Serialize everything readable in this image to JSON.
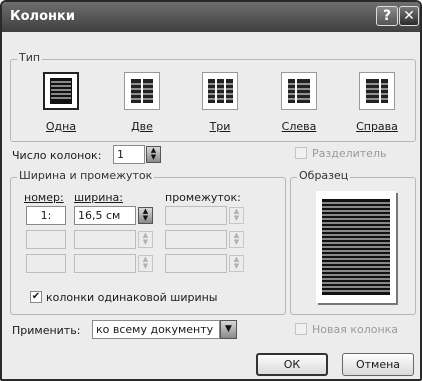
{
  "window": {
    "title": "Колонки",
    "help_glyph": "?",
    "close_glyph": "✕"
  },
  "type_group": {
    "legend": "Тип",
    "presets": [
      {
        "label": "Одна",
        "columns": 1,
        "selected": true
      },
      {
        "label": "Две",
        "columns": 2,
        "selected": false
      },
      {
        "label": "Три",
        "columns": 3,
        "selected": false
      },
      {
        "label": "Слева",
        "columns": "left",
        "selected": false
      },
      {
        "label": "Справа",
        "columns": "right",
        "selected": false
      }
    ]
  },
  "num_columns": {
    "label": "Число колонок:",
    "value": "1"
  },
  "separator": {
    "label": "Разделитель",
    "checked": false,
    "enabled": false
  },
  "width_group": {
    "legend": "Ширина и промежуток",
    "col_number_header": "номер:",
    "col_width_header": "ширина:",
    "col_spacing_header": "промежуток:",
    "rows": [
      {
        "number": "1:",
        "width": "16,5 см",
        "spacing": ""
      },
      {
        "number": "",
        "width": "",
        "spacing": ""
      },
      {
        "number": "",
        "width": "",
        "spacing": ""
      }
    ],
    "equal_width_label": "колонки одинаковой ширины",
    "equal_width_checked": true
  },
  "preview_group": {
    "legend": "Образец"
  },
  "apply": {
    "label": "Применить:",
    "value": "ко всему документу"
  },
  "new_column": {
    "label": "Новая колонка",
    "checked": false,
    "enabled": false
  },
  "buttons": {
    "ok": "ОК",
    "cancel": "Отмена"
  },
  "icons": {
    "spin_up": "▲",
    "spin_down": "▼",
    "dropdown": "▼",
    "check": "✔"
  },
  "colors": {
    "titlebar": "#4a4a4a",
    "dialog_bg": "#ececec"
  }
}
